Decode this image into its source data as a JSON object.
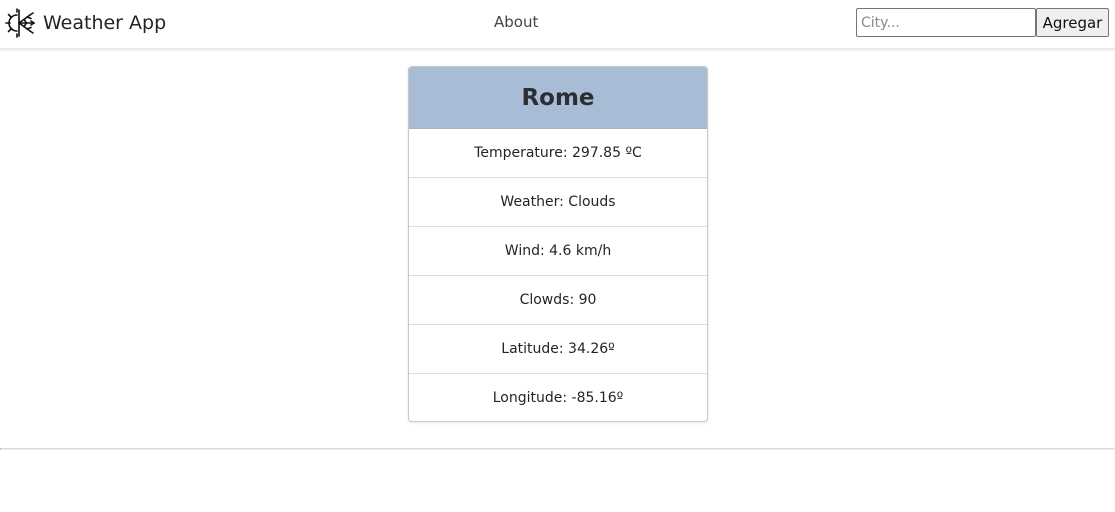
{
  "navbar": {
    "brand_icon": "snowflake-sun-icon",
    "brand_label": "Weather App",
    "about_label": "About",
    "search": {
      "placeholder": "City...",
      "value": "",
      "button_label": "Agregar"
    }
  },
  "city_card": {
    "title": "Rome",
    "header_color": "#a9bcd6",
    "rows": [
      "Temperature: 297.85 ºC",
      "Weather: Clouds",
      "Wind: 4.6 km/h",
      "Clowds: 90",
      "Latitude: 34.26º",
      "Longitude: -85.16º"
    ]
  }
}
